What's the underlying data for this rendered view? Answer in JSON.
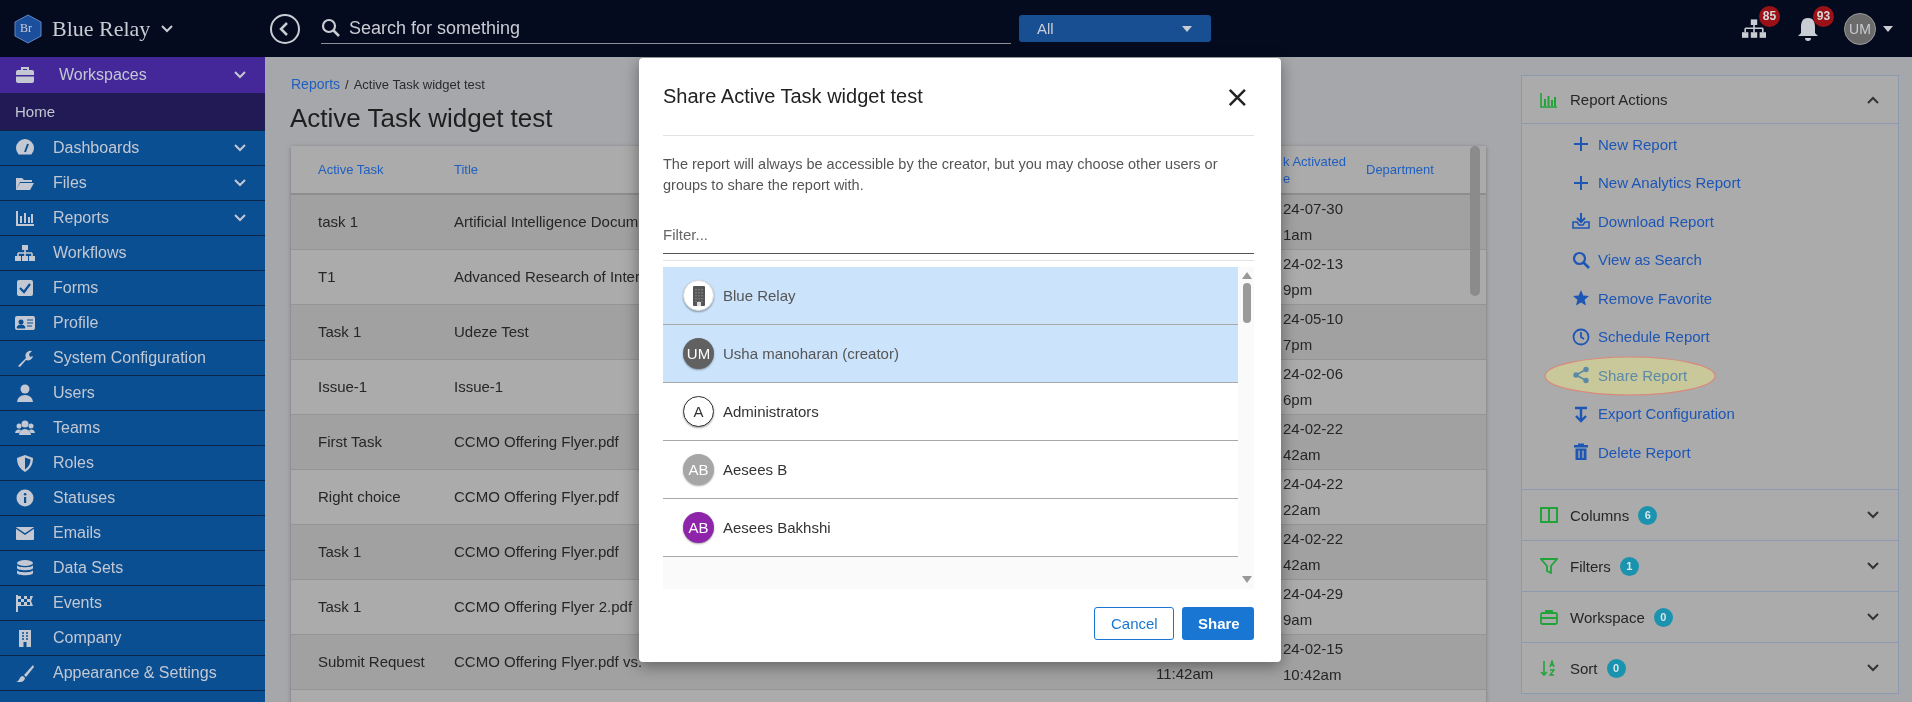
{
  "top_bar": {
    "logo_text": "Br",
    "brand": "Blue Relay",
    "search": {
      "placeholder": "Search for something"
    },
    "scope": "All",
    "org_badge": "85",
    "notification_badge": "93",
    "user_initials": "UM"
  },
  "sidebar": {
    "workspace": {
      "label": "Workspaces",
      "expanded": false
    },
    "home": "Home",
    "items": [
      {
        "label": "Dashboards",
        "expandable": true
      },
      {
        "label": "Files",
        "expandable": true
      },
      {
        "label": "Reports",
        "expandable": true
      },
      {
        "label": "Workflows",
        "expandable": false
      },
      {
        "label": "Forms",
        "expandable": false
      },
      {
        "label": "Profile",
        "expandable": false
      },
      {
        "label": "System Configuration",
        "expandable": false
      },
      {
        "label": "Users",
        "expandable": false
      },
      {
        "label": "Teams",
        "expandable": false
      },
      {
        "label": "Roles",
        "expandable": false
      },
      {
        "label": "Statuses",
        "expandable": false
      },
      {
        "label": "Emails",
        "expandable": false
      },
      {
        "label": "Data Sets",
        "expandable": false
      },
      {
        "label": "Events",
        "expandable": false
      },
      {
        "label": "Company",
        "expandable": false
      },
      {
        "label": "Appearance & Settings",
        "expandable": false
      }
    ]
  },
  "breadcrumb": {
    "link": "Reports",
    "separator": "/",
    "current": "Active Task widget test"
  },
  "page_title": "Active Task widget test",
  "table": {
    "columns": [
      {
        "label": "Active Task"
      },
      {
        "label": "Title"
      },
      {},
      {
        "label": "k Activated\ne"
      },
      {
        "label": "Department"
      }
    ],
    "rows": [
      {
        "active_task": "task 1",
        "title": "Artificial Intelligence Docum",
        "task_activated": "24-07-30\n1am"
      },
      {
        "active_task": "T1",
        "title": "Advanced Research of Inter",
        "task_activated": "24-02-13\n9pm"
      },
      {
        "active_task": "Task 1",
        "title": "Udeze Test",
        "task_activated": "24-05-10\n7pm"
      },
      {
        "active_task": "Issue-1",
        "title": "Issue-1",
        "task_activated": "24-02-06\n6pm"
      },
      {
        "active_task": "First Task",
        "title": "CCMO Offering Flyer.pdf",
        "task_activated": "24-02-22\n42am"
      },
      {
        "active_task": "Right choice",
        "title": "CCMO Offering Flyer.pdf",
        "task_activated": "24-04-22\n22am"
      },
      {
        "active_task": "Task 1",
        "title": "CCMO Offering Flyer.pdf",
        "task_activated": "24-02-22\n42am"
      },
      {
        "active_task": "Task 1",
        "title": "CCMO Offering Flyer 2.pdf",
        "task_activated": "24-04-29\n9am"
      },
      {
        "active_task": "Submit Request",
        "title": "CCMO Offering Flyer.pdf vs.",
        "column_3": "11:42am",
        "task_activated": "24-02-15\n10:42am"
      }
    ]
  },
  "report_actions": {
    "title": "Report Actions",
    "expanded": true,
    "items": [
      {
        "label": "New Report",
        "highlighted": false
      },
      {
        "label": "New Analytics Report",
        "highlighted": false
      },
      {
        "label": "Download Report",
        "highlighted": false
      },
      {
        "label": "View as Search",
        "highlighted": false
      },
      {
        "label": "Remove Favorite",
        "highlighted": false
      },
      {
        "label": "Schedule Report",
        "highlighted": false
      },
      {
        "label": "Share Report",
        "highlighted": true
      },
      {
        "label": "Export Configuration",
        "highlighted": false
      },
      {
        "label": "Delete Report",
        "highlighted": false
      }
    ]
  },
  "panel_sections": [
    {
      "label": "Columns",
      "count": "6",
      "expanded": false
    },
    {
      "label": "Filters",
      "count": "1",
      "expanded": false
    },
    {
      "label": "Workspace",
      "count": "0",
      "expanded": false
    },
    {
      "label": "Sort",
      "count": "0",
      "expanded": false
    }
  ],
  "dialog": {
    "title": "Share Active Task widget test",
    "close": "×",
    "description": "The report will always be accessible by the creator, but you may choose other users or groups to share the report with.",
    "filter": {
      "placeholder": "Filter..."
    },
    "options": [
      {
        "label": "Blue Relay",
        "selected": true,
        "avatar": {
          "kind": "icon"
        }
      },
      {
        "label": "Usha manoharan (creator)",
        "selected": true,
        "avatar": {
          "kind": "filled",
          "initials": "UM",
          "color": "#616161"
        }
      },
      {
        "label": "Administrators",
        "selected": false,
        "avatar": {
          "kind": "outline",
          "initials": "A",
          "color": "#333333"
        }
      },
      {
        "label": "Aesees B",
        "selected": false,
        "avatar": {
          "kind": "filled",
          "initials": "AB",
          "color": "#a6a6a6"
        }
      },
      {
        "label": "Aesees Bakhshi",
        "selected": false,
        "avatar": {
          "kind": "filled",
          "initials": "AB",
          "color": "#8e24aa"
        }
      }
    ],
    "buttons": [
      {
        "label": "Cancel",
        "kind": "secondary"
      },
      {
        "label": "Share",
        "kind": "primary"
      }
    ]
  }
}
